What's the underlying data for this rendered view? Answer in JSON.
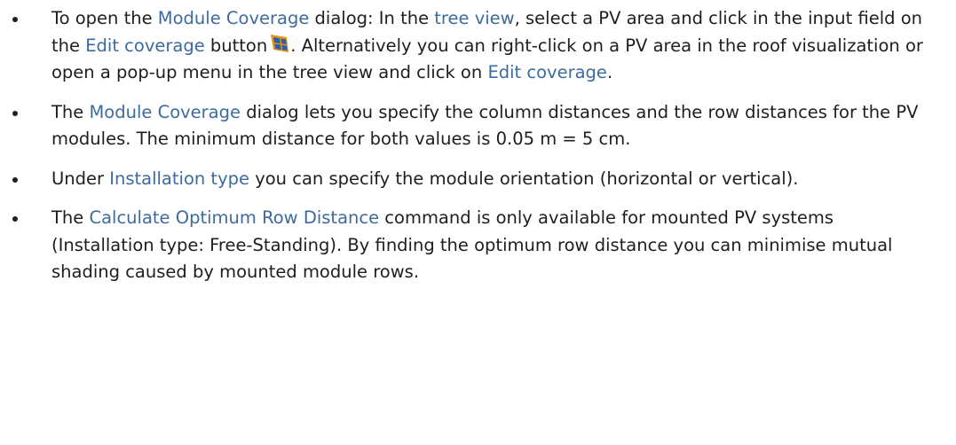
{
  "bullets": [
    {
      "parts": [
        {
          "t": "To open the "
        },
        {
          "t": "Module Coverage",
          "link": true
        },
        {
          "t": " dialog: In the "
        },
        {
          "t": "tree view",
          "link": true
        },
        {
          "t": ", select a PV area and click in the input field on the "
        },
        {
          "t": "Edit coverage",
          "link": true
        },
        {
          "t": " button"
        },
        {
          "icon": "solar-panel-icon"
        },
        {
          "t": ". Alternatively you can right-click on a PV area in the roof visualization or open a pop-up menu in the tree view and click on "
        },
        {
          "t": "Edit coverage",
          "link": true
        },
        {
          "t": "."
        }
      ]
    },
    {
      "parts": [
        {
          "t": "The "
        },
        {
          "t": "Module Coverage",
          "link": true
        },
        {
          "t": " dialog lets you specify the column distances and the row distances for the PV modules. The minimum distance for both values is 0.05 m = 5 cm."
        }
      ]
    },
    {
      "parts": [
        {
          "t": "Under "
        },
        {
          "t": "Installation type",
          "link": true
        },
        {
          "t": " you can specify the module orientation (horizontal or vertical)."
        }
      ]
    },
    {
      "parts": [
        {
          "t": "The "
        },
        {
          "t": "Calculate Optimum Row Distance",
          "link": true
        },
        {
          "t": " command is only available for mounted PV systems (Installation type: Free-Standing). By finding the optimum row distance you can minimise mutual shading caused by mounted module rows."
        }
      ]
    }
  ],
  "colors": {
    "text": "#1e1e1e",
    "link": "#3d6b9e",
    "icon_orange": "#e8921c",
    "icon_blue": "#2e5fa8"
  }
}
